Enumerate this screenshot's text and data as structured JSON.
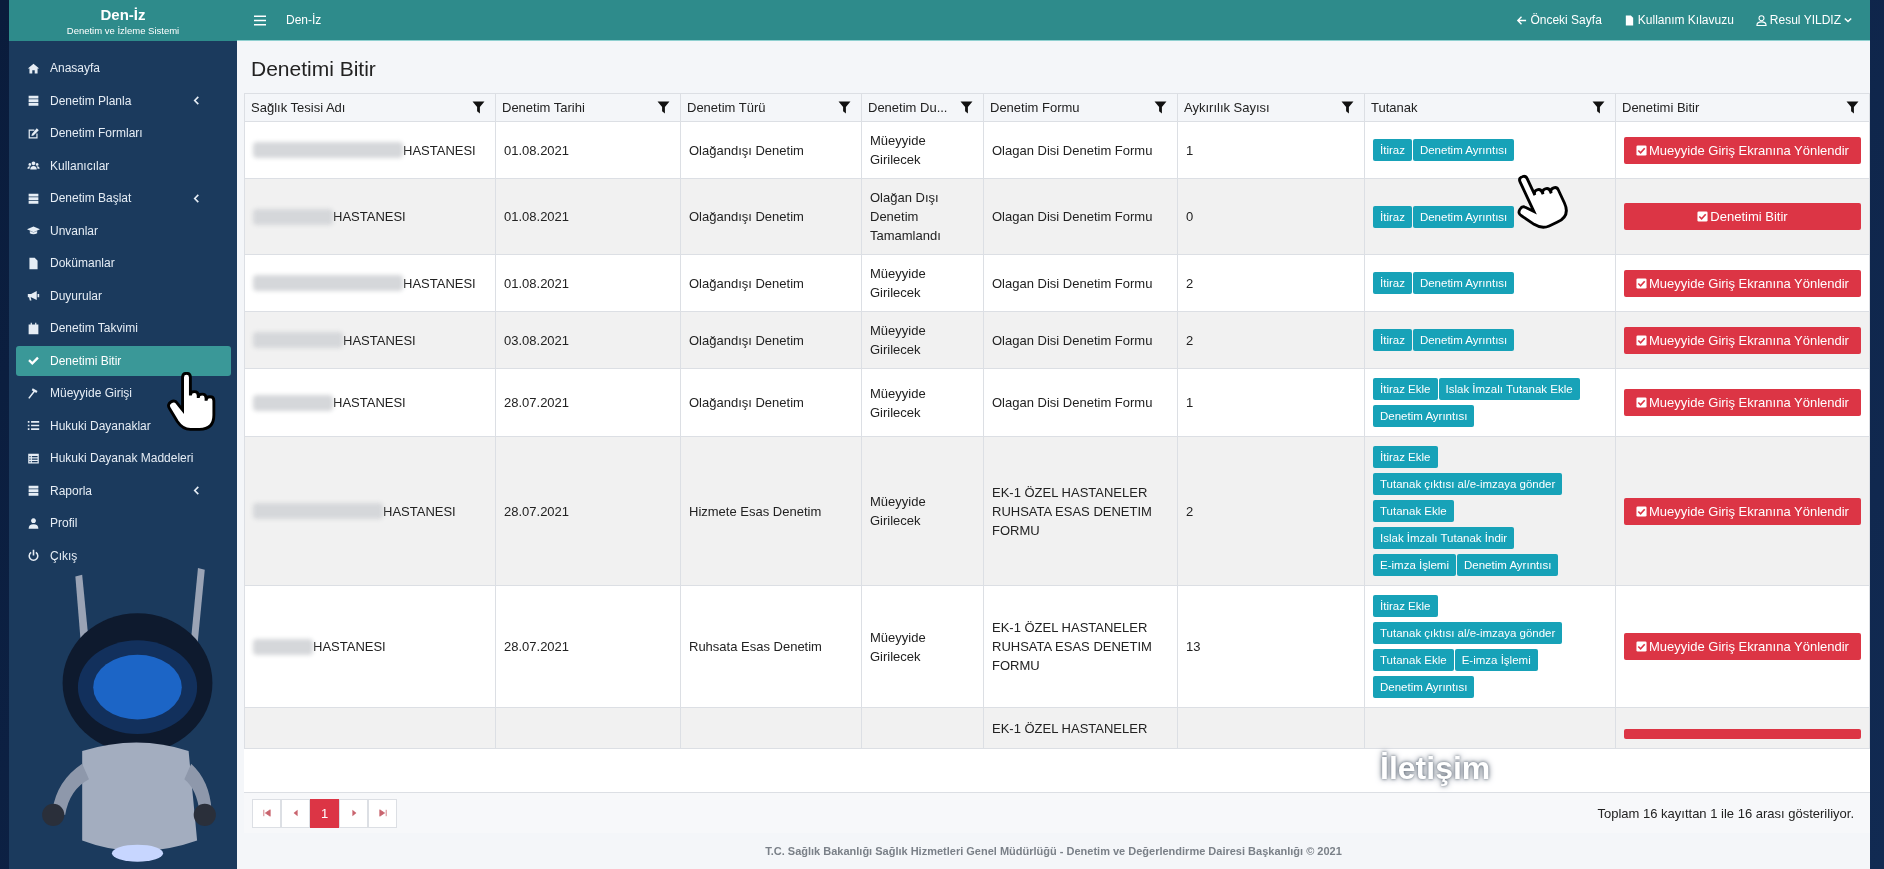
{
  "brand": {
    "title": "Den-İz",
    "subtitle": "Denetim ve İzleme Sistemi"
  },
  "topbar": {
    "title": "Den-İz",
    "links": [
      {
        "kind": "back",
        "label": "Önceki Sayfa"
      },
      {
        "kind": "guide",
        "label": "Kullanım Kılavuzu"
      },
      {
        "kind": "user",
        "label": "Resul YILDIZ"
      }
    ]
  },
  "sidebar": {
    "items": [
      {
        "label": "Anasayfa",
        "has_submenu": false,
        "selected": false
      },
      {
        "label": "Denetim Planla",
        "has_submenu": true,
        "selected": false
      },
      {
        "label": "Denetim Formları",
        "has_submenu": false,
        "selected": false
      },
      {
        "label": "Kullanıcılar",
        "has_submenu": false,
        "selected": false
      },
      {
        "label": "Denetim Başlat",
        "has_submenu": true,
        "selected": false
      },
      {
        "label": "Unvanlar",
        "has_submenu": false,
        "selected": false
      },
      {
        "label": "Dokümanlar",
        "has_submenu": false,
        "selected": false
      },
      {
        "label": "Duyurular",
        "has_submenu": false,
        "selected": false
      },
      {
        "label": "Denetim Takvimi",
        "has_submenu": false,
        "selected": false
      },
      {
        "label": "Denetimi Bitir",
        "has_submenu": false,
        "selected": true
      },
      {
        "label": "Müeyyide Girişi",
        "has_submenu": false,
        "selected": false
      },
      {
        "label": "Hukuki Dayanaklar",
        "has_submenu": false,
        "selected": false
      },
      {
        "label": "Hukuki Dayanak Maddeleri",
        "has_submenu": false,
        "selected": false
      },
      {
        "label": "Raporla",
        "has_submenu": true,
        "selected": false
      },
      {
        "label": "Profil",
        "has_submenu": false,
        "selected": false
      },
      {
        "label": "Çıkış",
        "has_submenu": false,
        "selected": false
      }
    ]
  },
  "page_title": "Denetimi Bitir",
  "table": {
    "columns": [
      "Sağlık Tesisi Adı",
      "Denetim Tarihi",
      "Denetim Türü",
      "Denetim Du...",
      "Denetim Formu",
      "Aykırılık Sayısı",
      "Tutanak",
      "Denetimi Bitir"
    ],
    "rows": [
      {
        "name": "HASTANESI",
        "redacted": true,
        "date": "01.08.2021",
        "type": "Olağandışı Denetim",
        "status": "Müeyyide Girilecek",
        "form": "Olagan Disi Denetim Formu",
        "count": "1",
        "actions": [
          [
            "İtiraz",
            "Denetim Ayrıntısı"
          ]
        ],
        "finish": "Mueyyide Giriş Ekranına Yönlendir"
      },
      {
        "name": "HASTANESI",
        "redacted": true,
        "date": "01.08.2021",
        "type": "Olağandışı Denetim",
        "status": "Olağan Dışı Denetim Tamamlandı",
        "form": "Olagan Disi Denetim Formu",
        "count": "0",
        "actions": [
          [
            "İtiraz",
            "Denetim Ayrıntısı"
          ]
        ],
        "finish": "Denetimi Bitir"
      },
      {
        "name": "HASTANESI",
        "redacted": true,
        "date": "01.08.2021",
        "type": "Olağandışı Denetim",
        "status": "Müeyyide Girilecek",
        "form": "Olagan Disi Denetim Formu",
        "count": "2",
        "actions": [
          [
            "İtiraz",
            "Denetim Ayrıntısı"
          ]
        ],
        "finish": "Mueyyide Giriş Ekranına Yönlendir"
      },
      {
        "name": "HASTANESI",
        "redacted": true,
        "date": "03.08.2021",
        "type": "Olağandışı Denetim",
        "status": "Müeyyide Girilecek",
        "form": "Olagan Disi Denetim Formu",
        "count": "2",
        "actions": [
          [
            "İtiraz",
            "Denetim Ayrıntısı"
          ]
        ],
        "finish": "Mueyyide Giriş Ekranına Yönlendir"
      },
      {
        "name": "HASTANESI",
        "redacted": true,
        "date": "28.07.2021",
        "type": "Olağandışı Denetim",
        "status": "Müeyyide Girilecek",
        "form": "Olagan Disi Denetim Formu",
        "count": "1",
        "actions": [
          [
            "İtiraz Ekle",
            "Islak İmzalı Tutanak Ekle"
          ],
          [
            "Denetim Ayrıntısı"
          ]
        ],
        "finish": "Mueyyide Giriş Ekranına Yönlendir"
      },
      {
        "name": "HASTANESI",
        "redacted": true,
        "date": "28.07.2021",
        "type": "Hizmete Esas Denetim",
        "status": "Müeyyide Girilecek",
        "form": "EK-1 ÖZEL HASTANELER RUHSATA ESAS DENETIM FORMU",
        "count": "2",
        "actions": [
          [
            "İtiraz Ekle"
          ],
          [
            "Tutanak çıktısı al/e-imzaya gönder"
          ],
          [
            "Tutanak Ekle"
          ],
          [
            "Islak İmzalı Tutanak İndir"
          ],
          [
            "E-imza İşlemi",
            "Denetim Ayrıntısı"
          ]
        ],
        "finish": "Mueyyide Giriş Ekranına Yönlendir"
      },
      {
        "name": "HASTANESI",
        "redacted": true,
        "date": "28.07.2021",
        "type": "Ruhsata Esas Denetim",
        "status": "Müeyyide Girilecek",
        "form": "EK-1 ÖZEL HASTANELER RUHSATA ESAS DENETIM FORMU",
        "count": "13",
        "actions": [
          [
            "İtiraz Ekle"
          ],
          [
            "Tutanak çıktısı al/e-imzaya gönder"
          ],
          [
            "Tutanak Ekle",
            "E-imza İşlemi"
          ],
          [
            "Denetim Ayrıntısı"
          ]
        ],
        "finish": "Mueyyide Giriş Ekranına Yönlendir"
      }
    ],
    "partial_row": {
      "form": "EK-1 ÖZEL HASTANELER"
    }
  },
  "pager": {
    "pages": [
      {
        "label": "1",
        "selected": true
      }
    ],
    "summary": "Toplam 16 kayıttan 1 ile 16 arası gösteriliyor."
  },
  "overlay_label": "İletişim",
  "footer": "T.C. Sağlık Bakanlığı Sağlık Hizmetleri Genel Müdürlüğü - Denetim ve Değerlendirme Dairesi Başkanlığı © 2021"
}
